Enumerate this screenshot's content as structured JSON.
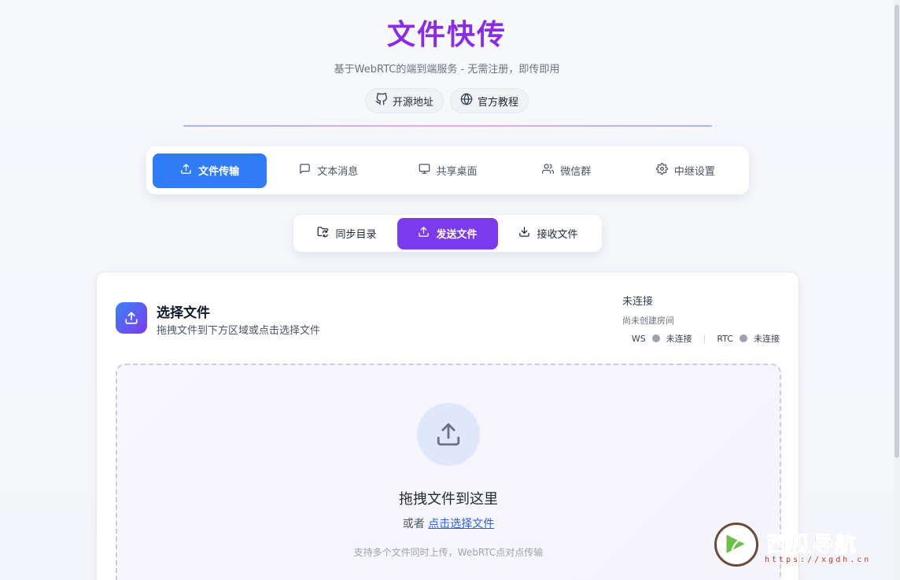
{
  "header": {
    "title": "文件快传",
    "subtitle": "基于WebRTC的端到端服务 - 无需注册，即传即用",
    "links": [
      {
        "label": "开源地址",
        "icon": "github-icon"
      },
      {
        "label": "官方教程",
        "icon": "globe-icon"
      }
    ]
  },
  "main_tabs": [
    {
      "label": "文件传输",
      "icon": "upload-icon",
      "active": true
    },
    {
      "label": "文本消息",
      "icon": "message-icon",
      "active": false
    },
    {
      "label": "共享桌面",
      "icon": "monitor-icon",
      "active": false
    },
    {
      "label": "微信群",
      "icon": "users-icon",
      "active": false
    },
    {
      "label": "中继设置",
      "icon": "gear-icon",
      "active": false
    }
  ],
  "sub_tabs": [
    {
      "label": "同步目录",
      "icon": "folder-sync-icon",
      "active": false
    },
    {
      "label": "发送文件",
      "icon": "upload-icon",
      "active": true
    },
    {
      "label": "接收文件",
      "icon": "download-icon",
      "active": false
    }
  ],
  "card": {
    "title": "选择文件",
    "description": "拖拽文件到下方区域或点击选择文件",
    "status": {
      "main": "未连接",
      "sub": "尚未创建房间",
      "ws_label": "WS",
      "ws_status": "未连接",
      "rtc_label": "RTC",
      "rtc_status": "未连接",
      "separator": "|"
    },
    "dropzone": {
      "title": "拖拽文件到这里",
      "or_text": "或者",
      "select_link": "点击选择文件",
      "hint": "支持多个文件同时上传，WebRTC点对点传输"
    }
  },
  "watermark": {
    "text": "西瓜导航",
    "url": "https://xgdh.cn"
  },
  "colors": {
    "title": "#8b2be2",
    "main_tab_active": "#2f7cf6",
    "sub_tab_active": "#7c3aed",
    "link": "#2563eb",
    "status_dot": "#9ca3af"
  }
}
